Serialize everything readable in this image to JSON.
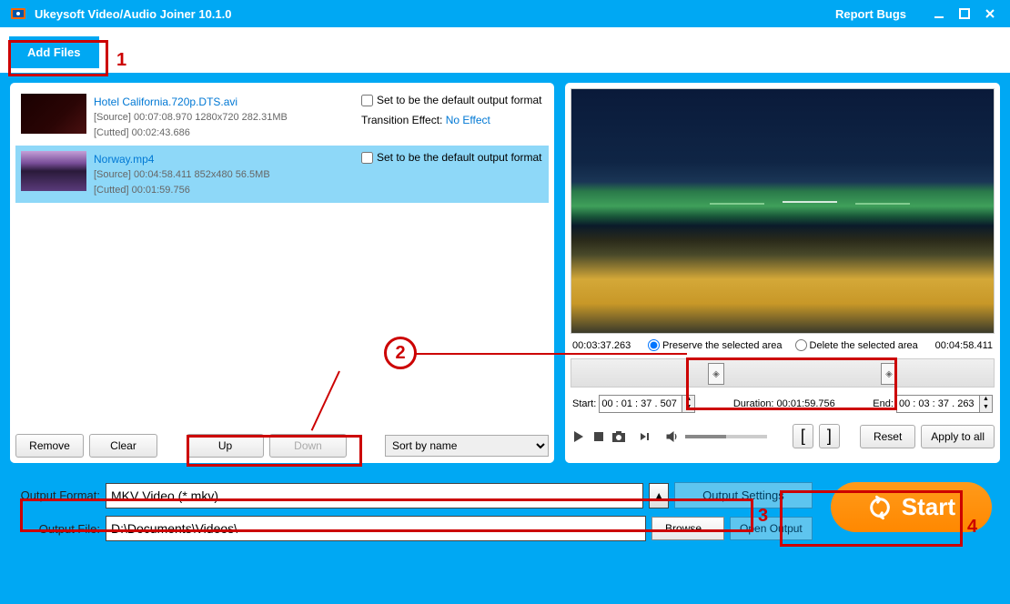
{
  "titlebar": {
    "title": "Ukeysoft Video/Audio Joiner 10.1.0",
    "report": "Report Bugs"
  },
  "toolbar": {
    "add_files": "Add Files"
  },
  "files": [
    {
      "name": "Hotel California.720p.DTS.avi",
      "source": "[Source]  00:07:08.970  1280x720  282.31MB",
      "cutted": "[Cutted]  00:02:43.686",
      "default_label": "Set to be the default output format",
      "trans_label": "Transition Effect:",
      "trans_value": "No Effect"
    },
    {
      "name": "Norway.mp4",
      "source": "[Source]  00:04:58.411  852x480  56.5MB",
      "cutted": "[Cutted]  00:01:59.756",
      "default_label": "Set to be the default output format"
    }
  ],
  "list_buttons": {
    "remove": "Remove",
    "clear": "Clear",
    "up": "Up",
    "down": "Down",
    "sort": "Sort by name"
  },
  "preview": {
    "time_left": "00:03:37.263",
    "time_right": "00:04:58.411",
    "radio_preserve": "Preserve the selected area",
    "radio_delete": "Delete the selected area",
    "start_label": "Start:",
    "start_val": "00 : 01 : 37 . 507",
    "duration_label": "Duration: 00:01:59.756",
    "end_label": "End:",
    "end_val": "00 : 03 : 37 . 263",
    "reset": "Reset",
    "apply": "Apply to all"
  },
  "output": {
    "format_label": "Output Format:",
    "format_value": "MKV Video (*.mkv)",
    "settings": "Output Settings",
    "file_label": "Output File:",
    "file_value": "D:\\Documents\\Videos\\",
    "browse": "Browse...",
    "open": "Open Output"
  },
  "start": "Start",
  "annotations": {
    "n1": "1",
    "n2": "2",
    "n3": "3",
    "n4": "4"
  }
}
